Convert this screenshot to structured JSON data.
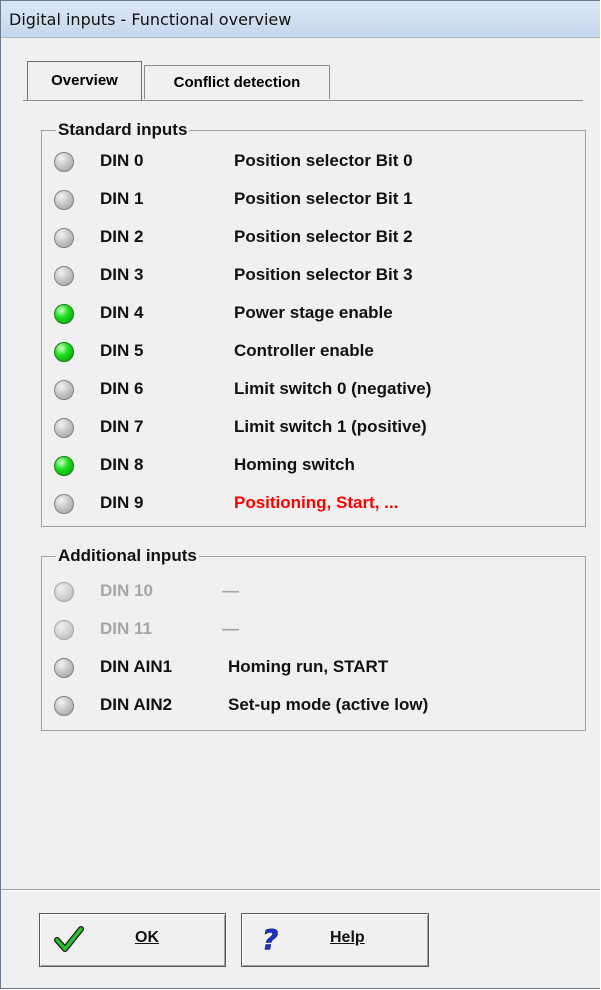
{
  "window": {
    "title": "Digital inputs - Functional overview"
  },
  "tabs": [
    {
      "label": "Overview"
    },
    {
      "label": "Conflict detection"
    }
  ],
  "standard": {
    "legend": "Standard inputs",
    "rows": [
      {
        "din": "DIN 0",
        "func": "Position selector Bit 0",
        "state": "off"
      },
      {
        "din": "DIN 1",
        "func": "Position selector Bit 1",
        "state": "off"
      },
      {
        "din": "DIN 2",
        "func": "Position selector Bit 2",
        "state": "off"
      },
      {
        "din": "DIN 3",
        "func": "Position selector Bit 3",
        "state": "off"
      },
      {
        "din": "DIN 4",
        "func": "Power stage enable",
        "state": "on"
      },
      {
        "din": "DIN 5",
        "func": "Controller enable",
        "state": "on"
      },
      {
        "din": "DIN 6",
        "func": "Limit switch 0 (negative)",
        "state": "off"
      },
      {
        "din": "DIN 7",
        "func": "Limit switch 1 (positive)",
        "state": "off"
      },
      {
        "din": "DIN 8",
        "func": "Homing switch",
        "state": "on"
      },
      {
        "din": "DIN 9",
        "func": "Positioning, Start, ...",
        "state": "off",
        "func_color": "#ff0000"
      }
    ]
  },
  "additional": {
    "legend": "Additional inputs",
    "rows": [
      {
        "din": "DIN 10",
        "func": "—",
        "state": "disabled"
      },
      {
        "din": "DIN 11",
        "func": "—",
        "state": "disabled"
      },
      {
        "din": "DIN AIN1",
        "func": "Homing run, START",
        "state": "off"
      },
      {
        "din": "DIN AIN2",
        "func": "Set-up mode (active low)",
        "state": "off"
      }
    ]
  },
  "buttons": {
    "ok": {
      "label": "OK",
      "icon": "checkmark-icon"
    },
    "help": {
      "label": "Help",
      "icon": "question-mark-icon"
    }
  },
  "colors": {
    "led_on": "#1fe01f",
    "warning_text": "#ff0000",
    "disabled_text": "#a6a6a6"
  }
}
